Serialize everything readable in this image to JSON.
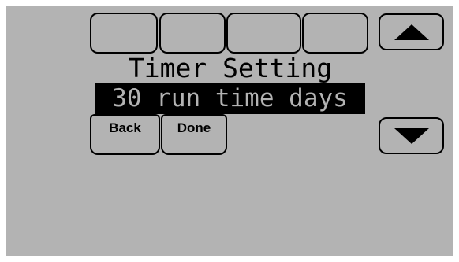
{
  "screen": {
    "title": "Timer Setting",
    "value": "30 run time days"
  },
  "buttons": {
    "back_label": "Back",
    "done_label": "Done"
  },
  "icons": {
    "up": "triangle-up-icon",
    "down": "triangle-down-icon"
  },
  "colors": {
    "screen_background": "#b3b3b3",
    "foreground": "#000000"
  }
}
